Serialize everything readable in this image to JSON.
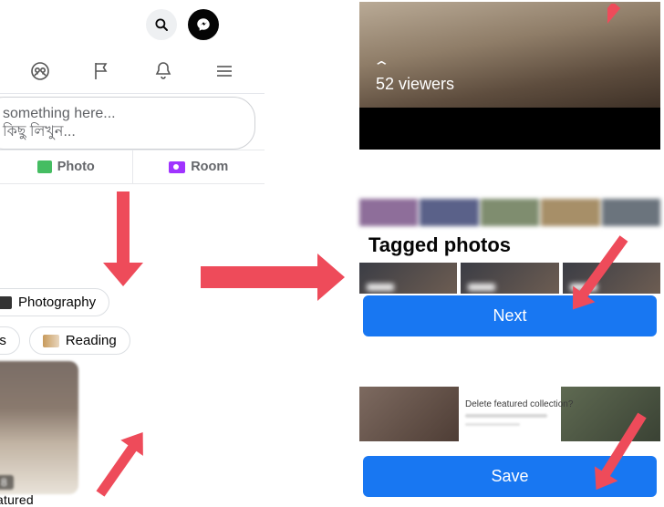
{
  "top": {
    "search_icon": "search",
    "messenger_icon": "messenger"
  },
  "nav": {
    "groups": "groups-icon",
    "flag": "flag-icon",
    "bell": "bell-icon",
    "menu": "menu-icon"
  },
  "composer": {
    "line1": "something here...",
    "line2": "কিছু লিখুন..."
  },
  "post_actions": {
    "photo": "Photo",
    "room": "Room"
  },
  "hobbies": {
    "photography": "Photography",
    "partial_es": "es",
    "reading": "Reading"
  },
  "featured": {
    "count": "8",
    "label": "atured"
  },
  "viewer": {
    "count_text": "52 viewers"
  },
  "tagged": {
    "title": "Tagged photos",
    "next_btn": "Next"
  },
  "delete_dialog": {
    "title": "Delete featured collection?"
  },
  "save_btn": "Save"
}
